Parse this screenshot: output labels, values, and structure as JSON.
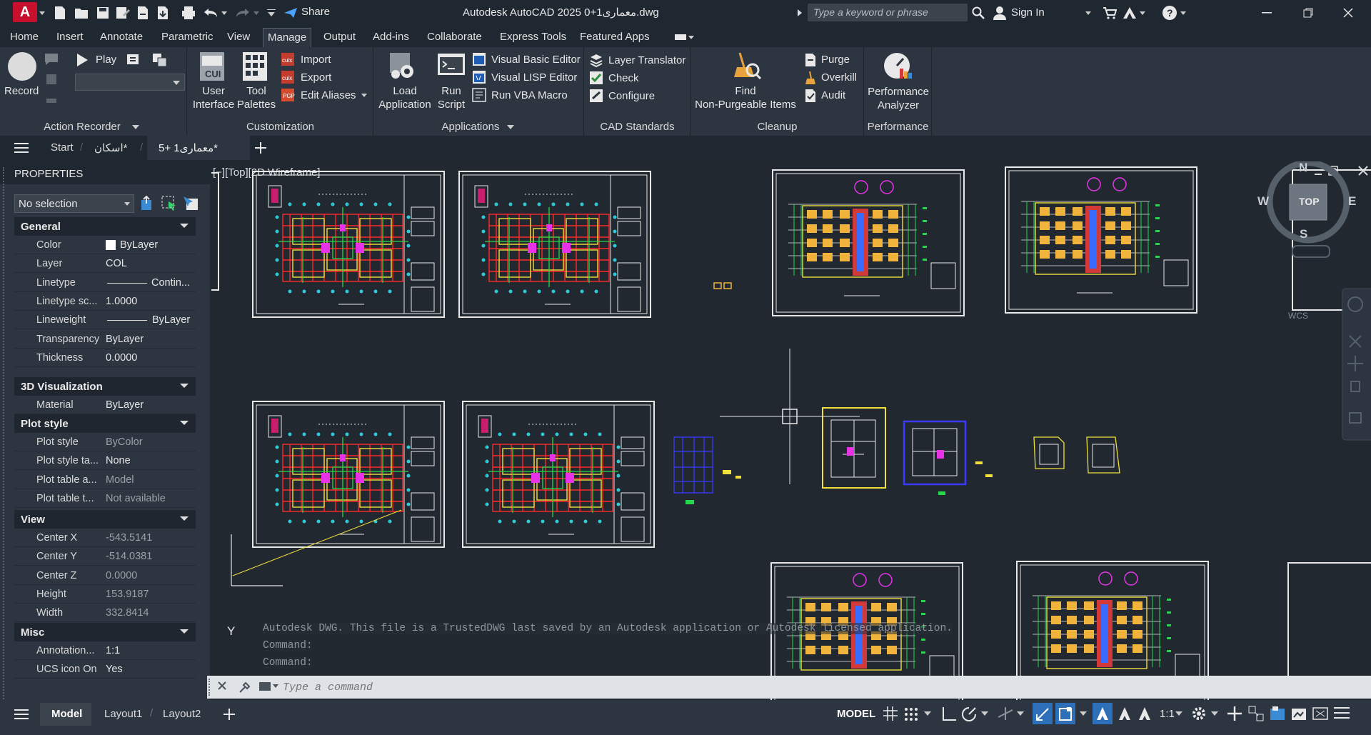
{
  "app": {
    "letter": "A",
    "title": "Autodesk AutoCAD 2025   0+معماری1.dwg",
    "share": "Share",
    "search_placeholder": "Type a keyword or phrase",
    "sign_in": "Sign In"
  },
  "ribbon_tabs": [
    "Home",
    "Insert",
    "Annotate",
    "Parametric",
    "View",
    "Manage",
    "Output",
    "Add-ins",
    "Collaborate",
    "Express Tools",
    "Featured Apps"
  ],
  "ribbon": {
    "action_recorder": {
      "record": "Record",
      "play": "Play",
      "label": "Action Recorder"
    },
    "customization": {
      "user_interface_1": "User",
      "user_interface_2": "Interface",
      "tool_palettes_1": "Tool",
      "tool_palettes_2": "Palettes",
      "import": "Import",
      "export": "Export",
      "edit_aliases": "Edit Aliases",
      "label": "Customization"
    },
    "applications": {
      "load_1": "Load",
      "load_2": "Application",
      "run_1": "Run",
      "run_2": "Script",
      "vba_editor": "Visual Basic Editor",
      "lisp_editor": "Visual LISP Editor",
      "run_vba": "Run VBA Macro",
      "label": "Applications"
    },
    "cad_standards": {
      "layer_translator": "Layer Translator",
      "check": "Check",
      "configure": "Configure",
      "label": "CAD Standards"
    },
    "cleanup": {
      "find_1": "Find",
      "find_2": "Non-Purgeable Items",
      "purge": "Purge",
      "overkill": "Overkill",
      "audit": "Audit",
      "label": "Cleanup"
    },
    "performance": {
      "analyzer_1": "Performance",
      "analyzer_2": "Analyzer",
      "label": "Performance"
    }
  },
  "doc_tabs": [
    "Start",
    "اسکان*",
    "معماری1 +5*"
  ],
  "properties": {
    "title": "PROPERTIES",
    "selection": "No selection",
    "sections": {
      "general": "General",
      "viz": "3D Visualization",
      "plot": "Plot style",
      "view": "View",
      "misc": "Misc"
    },
    "general": [
      [
        "Color",
        "ByLayer"
      ],
      [
        "Layer",
        "COL"
      ],
      [
        "Linetype",
        "Contin..."
      ],
      [
        "Linetype sc...",
        "1.0000"
      ],
      [
        "Lineweight",
        "ByLayer"
      ],
      [
        "Transparency",
        "ByLayer"
      ],
      [
        "Thickness",
        "0.0000"
      ]
    ],
    "viz": [
      [
        "Material",
        "ByLayer"
      ]
    ],
    "plot": [
      [
        "Plot style",
        "ByColor"
      ],
      [
        "Plot style ta...",
        "None"
      ],
      [
        "Plot table a...",
        "Model"
      ],
      [
        "Plot table t...",
        "Not available"
      ]
    ],
    "view": [
      [
        "Center X",
        "-543.5141"
      ],
      [
        "Center Y",
        "-514.0381"
      ],
      [
        "Center Z",
        "0.0000"
      ],
      [
        "Height",
        "153.9187"
      ],
      [
        "Width",
        "332.8414"
      ]
    ],
    "misc": [
      [
        "Annotation...",
        "1:1"
      ],
      [
        "UCS icon On",
        "Yes"
      ]
    ]
  },
  "viewport": {
    "label": "[−][Top][2D Wireframe]",
    "cube_top": "TOP",
    "n": "N",
    "s": "S",
    "e": "E",
    "w": "W",
    "wcs": "WCS",
    "ucs_y": "Y"
  },
  "command": {
    "history_1": "Autodesk DWG.  This file is a TrustedDWG last saved by an Autodesk application or Autodesk licensed application.",
    "history_2": "Command:",
    "history_3": "Command:",
    "placeholder": "Type a command"
  },
  "status": {
    "model_tab": "Model",
    "layout1": "Layout1",
    "layout2": "Layout2",
    "model": "MODEL",
    "scale": "1:1"
  }
}
